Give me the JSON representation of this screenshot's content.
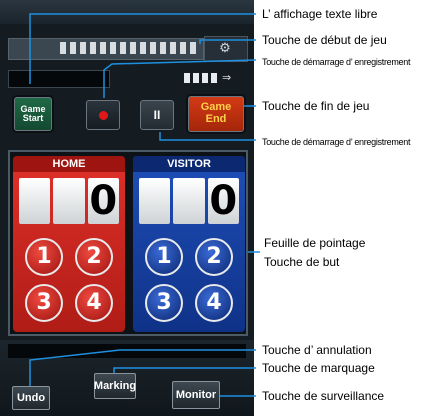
{
  "controls": {
    "game_start": "Game Start",
    "pause": "II",
    "game_end": "Game End"
  },
  "scoreboard": {
    "home": {
      "label": "HOME",
      "digits": [
        "",
        "",
        "0"
      ],
      "goals": [
        "1",
        "2",
        "3",
        "4"
      ]
    },
    "visitor": {
      "label": "VISITOR",
      "digits": [
        "",
        "",
        "0"
      ],
      "goals": [
        "1",
        "2",
        "3",
        "4"
      ]
    }
  },
  "bottom": {
    "undo": "Undo",
    "marking": "Marking",
    "monitor": "Monitor"
  },
  "callouts": {
    "free_text": "L’ affichage texte libre",
    "game_start": "Touche de début de jeu",
    "record_start_1": "Touche de démarrage d’ enregistrement",
    "game_end": "Touche de fin de jeu",
    "record_start_2": "Touche de démarrage d’ enregistrement",
    "score_sheet": "Feuille de pointage",
    "goal": "Touche de but",
    "undo": "Touche d’ annulation",
    "marking": "Touche de marquage",
    "monitor": "Touche de surveillance"
  },
  "colors": {
    "callout_line": "#1e90e0",
    "home": "#e0302a",
    "visitor": "#1e4fb8",
    "game_start": "#1f6a46",
    "game_end": "#d43a16"
  }
}
